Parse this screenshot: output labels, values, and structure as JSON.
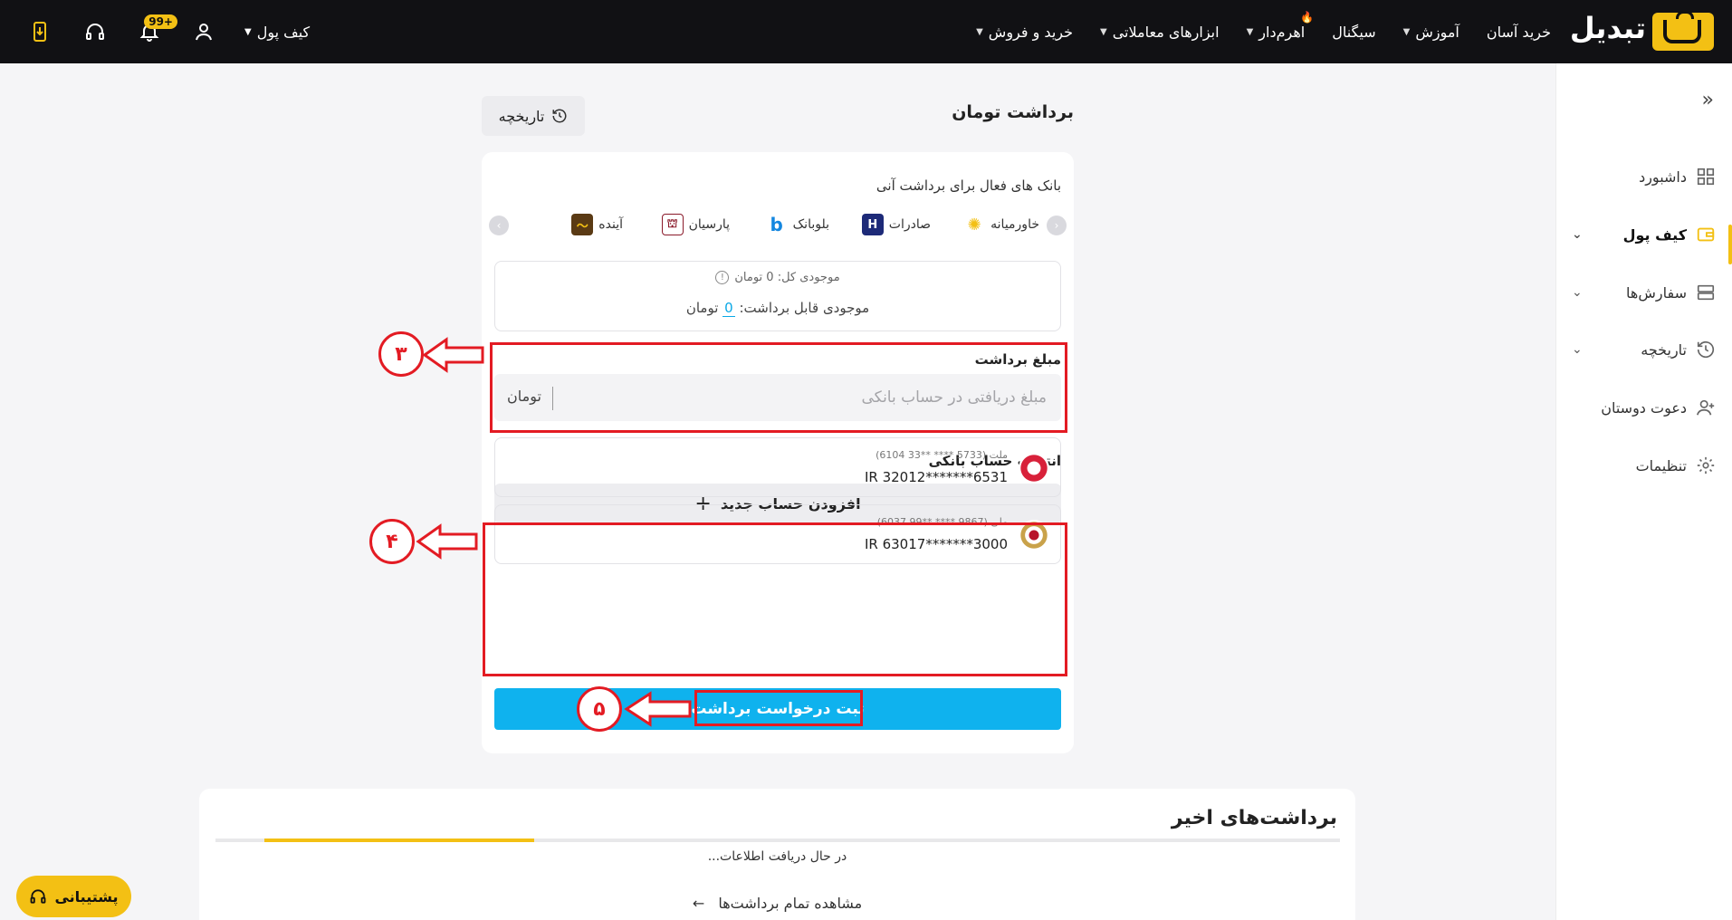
{
  "brand": {
    "name": "تبدیل",
    "color": "#f3c014"
  },
  "nav": {
    "items": [
      {
        "label": "خرید و فروش",
        "dropdown": true
      },
      {
        "label": "ابزارهای معاملاتی",
        "dropdown": true
      },
      {
        "label": "اهرم‌دار",
        "dropdown": true,
        "hot": true
      },
      {
        "label": "سیگنال",
        "dropdown": false
      },
      {
        "label": "آموزش",
        "dropdown": true
      },
      {
        "label": "خرید آسان",
        "dropdown": false
      }
    ],
    "wallet_label": "کیف پول",
    "notification_badge": "99+"
  },
  "sidebar": {
    "items": [
      {
        "label": "داشبورد",
        "icon": "dashboard-icon",
        "expandable": false
      },
      {
        "label": "کیف پول",
        "icon": "wallet-icon",
        "expandable": true,
        "active": true
      },
      {
        "label": "سفارش‌ها",
        "icon": "orders-icon",
        "expandable": true
      },
      {
        "label": "تاریخچه",
        "icon": "history-icon",
        "expandable": true
      },
      {
        "label": "دعوت دوستان",
        "icon": "invite-icon",
        "expandable": false
      },
      {
        "label": "تنظیمات",
        "icon": "settings-icon",
        "expandable": false
      }
    ]
  },
  "withdraw": {
    "title": "برداشت تومان",
    "history_button": "تاریخچه",
    "banks_title": "بانک های فعال برای برداشت آنی",
    "banks": [
      {
        "name": "خاورمیانه",
        "color": "#f3c014"
      },
      {
        "name": "صادرات",
        "color": "#1d2a78"
      },
      {
        "name": "بلوبانک",
        "color": "#1487e0"
      },
      {
        "name": "پارسیان",
        "color": "#8a1a2a"
      },
      {
        "name": "آینده",
        "color": "#5a3a14"
      }
    ],
    "balance_total": "موجودی کل: 0 تومان",
    "balance_available_prefix": "موجودی قابل برداشت:",
    "balance_available_value": "0",
    "balance_available_unit": "تومان",
    "amount_label": "مبلغ برداشت",
    "amount_placeholder": "مبلغ دریافتی در حساب بانکی",
    "amount_unit": "تومان",
    "account_label": "انتخاب حساب بانکی",
    "add_account": "افزودن حساب جدید",
    "accounts": [
      {
        "bank": "ملت (5733 **** **33 6104)",
        "iban": "IR 32012*******6531"
      },
      {
        "bank": "ملی (9867 **** **99 6037)",
        "iban": "IR 63017*******3000"
      }
    ],
    "submit": "ثبت درخواست برداشت"
  },
  "annotations": {
    "step3": "۳",
    "step4": "۴",
    "step5": "۵",
    "color": "#e31b23"
  },
  "recent": {
    "title": "برداشت‌های اخیر",
    "loading": "در حال دریافت اطلاعات...",
    "view_all": "مشاهده تمام برداشت‌ها",
    "progress": 0.24
  },
  "support": {
    "label": "پشتیبانی"
  }
}
